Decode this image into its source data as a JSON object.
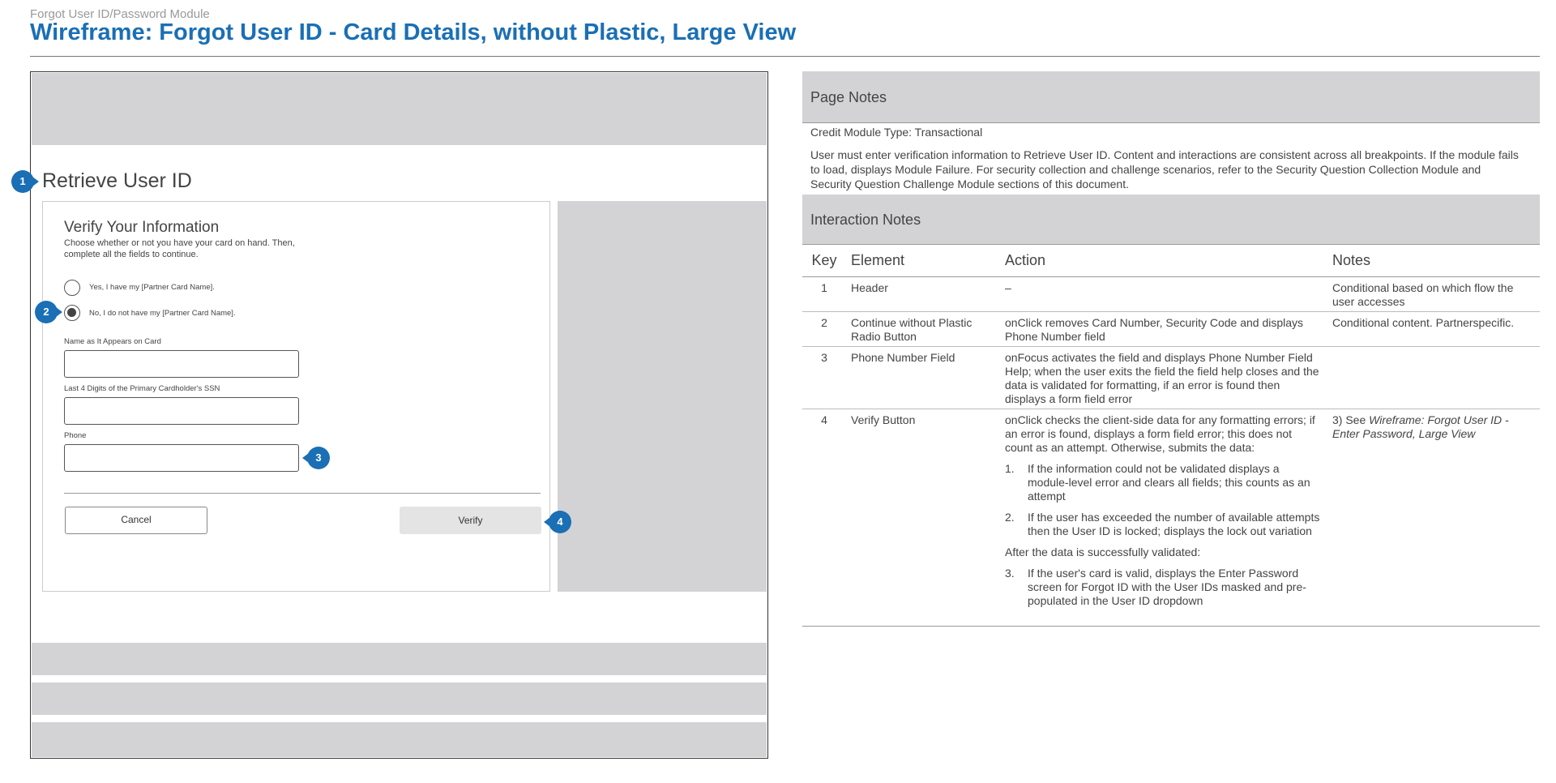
{
  "document": {
    "subtitle": "Forgot User ID/Password Module",
    "title": "Wireframe: Forgot User ID - Card Details, without Plastic, Large View"
  },
  "wireframe": {
    "heading": "Retrieve User ID",
    "form": {
      "heading": "Verify Your Information",
      "instructions": "Choose whether or not you have your card on hand. Then, complete all the fields to continue.",
      "radio_yes_label": "Yes, I have my [Partner Card Name].",
      "radio_no_label": "No, I do not have my [Partner Card Name].",
      "selected_option": "no",
      "name_label": "Name as It Appears on Card",
      "ssn_label": "Last 4 Digits of the Primary Cardholder's SSN",
      "phone_label": "Phone",
      "cancel_label": "Cancel",
      "verify_label": "Verify"
    },
    "markers": [
      "1",
      "2",
      "3",
      "4"
    ],
    "marker_color": "#1a6fb5"
  },
  "notes": {
    "page_notes_title": "Page Notes",
    "module_type": "Credit Module Type: Transactional",
    "paragraph": "User must enter verification information to Retrieve User ID. Content and interactions are consistent across all breakpoints. If the module fails to load, displays Module Failure. For security collection and challenge scenarios, refer to the Security Question Collection Module and Security Question Challenge Module sections of this document.",
    "interaction_title": "Interaction Notes",
    "columns": {
      "key": "Key",
      "element": "Element",
      "action": "Action",
      "notes": "Notes"
    },
    "rows": [
      {
        "key": "1",
        "element": "Header",
        "action": "–",
        "notes": "Conditional based on which flow the user accesses"
      },
      {
        "key": "2",
        "element": "Continue without Plastic Radio Button",
        "action": "onClick removes Card Number, Security Code and displays Phone Number field",
        "notes": "Conditional content. Partnerspecific."
      },
      {
        "key": "3",
        "element": "Phone Number Field",
        "action": "onFocus activates the field and displays Phone Number Field Help; when the user exits the field the field help closes and the data is validated for formatting, if an error is found then displays a form field error",
        "notes": ""
      },
      {
        "key": "4",
        "element": "Verify Button",
        "action": "onClick checks the client-side data for any formatting errors; if an error is found, displays a form field error; this does not count as an attempt. Otherwise, submits the data:",
        "list": [
          {
            "num": "1.",
            "text": "If the information could not be validated displays a module-level error and clears all fields; this counts as an attempt"
          },
          {
            "num": "2.",
            "text": "If the user has exceeded the number of available attempts then the User ID is locked; displays the lock out variation"
          }
        ],
        "after_text": "After the data is successfully validated:",
        "list2": [
          {
            "num": "3.",
            "text": "If the user's card is valid, displays the Enter Password screen for Forgot ID with the User IDs masked and pre-populated in the User ID dropdown"
          }
        ],
        "notes_prefix": "3) See ",
        "notes_ref": "Wireframe: Forgot User ID - Enter Password, Large View"
      }
    ]
  }
}
